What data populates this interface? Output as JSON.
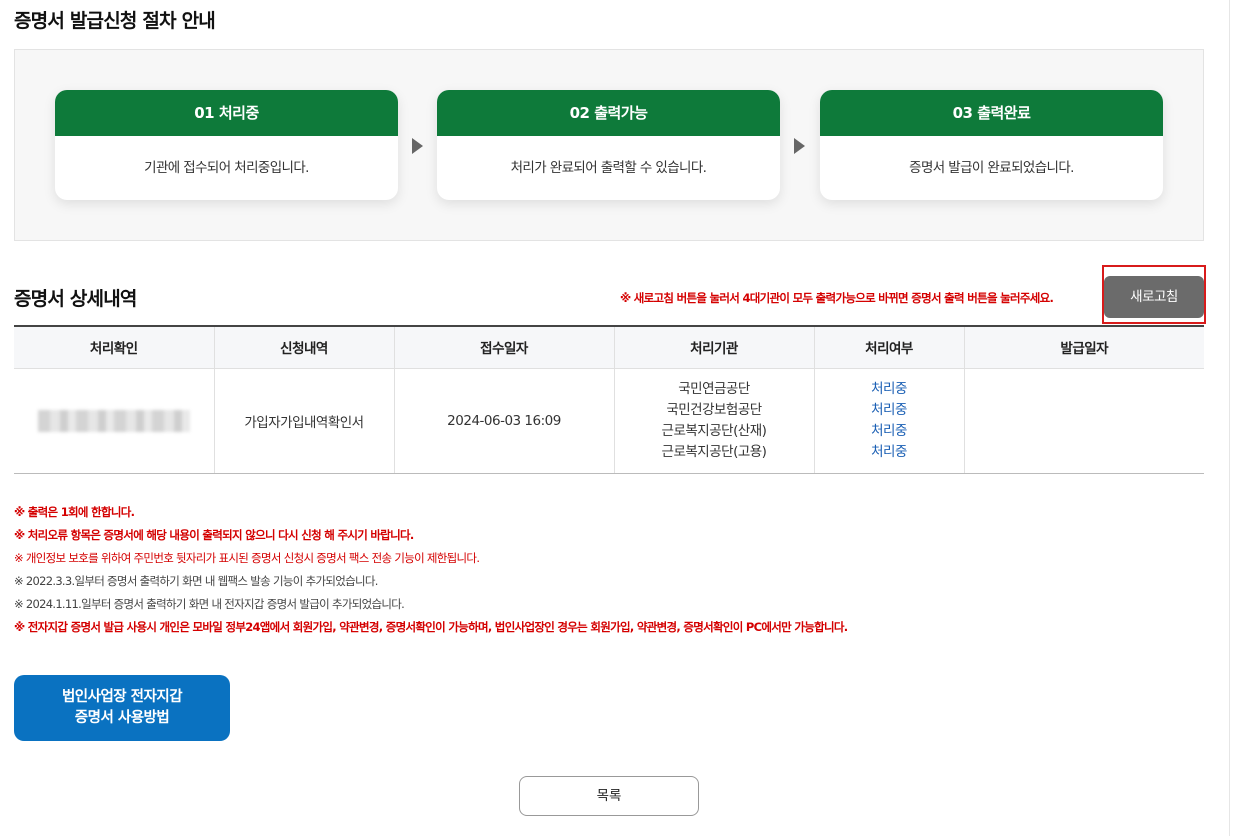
{
  "procedure": {
    "title": "증명서 발급신청 절차 안내",
    "steps": [
      {
        "head": "01 처리중",
        "body": "기관에 접수되어 처리중입니다."
      },
      {
        "head": "02 출력가능",
        "body": "처리가 완료되어 출력할 수 있습니다."
      },
      {
        "head": "03 출력완료",
        "body": "증명서 발급이 완료되었습니다."
      }
    ]
  },
  "detail": {
    "title": "증명서 상세내역",
    "notice": "※ 새로고침 버튼을 눌러서 4대기관이 모두 출력가능으로 바뀌면 증명서 출력 버튼을 눌러주세요.",
    "refresh_label": "새로고침",
    "columns": [
      "처리확인",
      "신청내역",
      "접수일자",
      "처리기관",
      "처리여부",
      "발급일자"
    ],
    "row": {
      "check": "",
      "request": "가입자가입내역확인서",
      "date": "2024-06-03 16:09",
      "agencies": [
        "국민연금공단",
        "국민건강보험공단",
        "근로복지공단(산재)",
        "근로복지공단(고용)"
      ],
      "statuses": [
        "처리중",
        "처리중",
        "처리중",
        "처리중"
      ],
      "issue_date": ""
    }
  },
  "notes": [
    "※ 출력은 1회에 한합니다.",
    "※ 처리오류 항목은 증명서에 해당 내용이 출력되지 않으니 다시 신청 해 주시기 바랍니다.",
    "※ 개인정보 보호를 위하여 주민번호 뒷자리가 표시된 증명서 신청시 증명서 팩스 전송 기능이 제한됩니다.",
    "※ 2022.3.3.일부터 증명서 출력하기 화면 내 웹팩스 발송 기능이 추가되었습니다.",
    "※ 2024.1.11.일부터 증명서 출력하기 화면 내 전자지갑 증명서 발급이 추가되었습니다.",
    "※ 전자지갑 증명서 발급 사용시 개인은 모바일 정부24앱에서 회원가입, 약관변경, 증명서확인이 가능하며, 법인사업장인 경우는 회원가입, 약관변경, 증명서확인이 PC에서만 가능합니다."
  ],
  "guide_button": {
    "line1": "법인사업장 전자지갑",
    "line2": "증명서 사용방법"
  },
  "list_button": "목록",
  "colors": {
    "green": "#0e7a3a",
    "blue": "#0a72c1",
    "red": "#d40000",
    "refresh": "#6b6b6b"
  }
}
